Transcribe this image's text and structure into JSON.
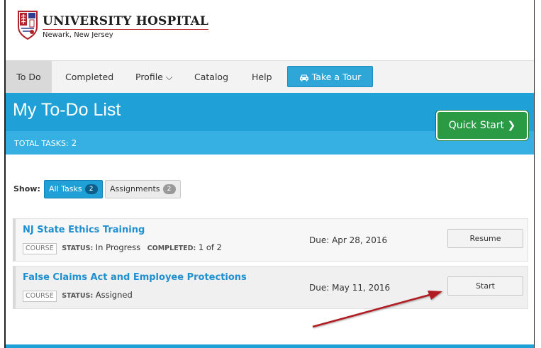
{
  "brand": {
    "title": "UNIVERSITY HOSPITAL",
    "subtitle": "Newark, New Jersey",
    "logo_icon": "hospital-shield-logo",
    "accent": "#b0232a"
  },
  "nav": {
    "items": [
      {
        "label": "To Do",
        "active": true
      },
      {
        "label": "Completed"
      },
      {
        "label": "Profile ⌵"
      },
      {
        "label": "Catalog"
      },
      {
        "label": "Help"
      }
    ],
    "tour_label": "Take a Tour",
    "tour_icon": "car-icon",
    "tour_color": "#2ea7d8"
  },
  "banner": {
    "title": "My To-Do List",
    "quick_start_label": "Quick Start ❯",
    "total_tasks_label": "TOTAL TASKS:",
    "total_tasks_count": "2",
    "color": "#1fa0d6",
    "quick_start_color": "#2a9a45"
  },
  "filters": {
    "show_label": "Show:",
    "all_tasks_label": "All Tasks",
    "all_tasks_count": "2",
    "assignments_label": "Assignments",
    "assignments_count": "2"
  },
  "tasks": [
    {
      "title": "NJ State Ethics Training",
      "type": "COURSE",
      "status_key": "STATUS:",
      "status": "In Progress",
      "completed_key": "COMPLETED:",
      "completed": "1 of 2",
      "due": "Due: Apr 28, 2016",
      "action": "Resume"
    },
    {
      "title": "False Claims Act and Employee Protections",
      "type": "COURSE",
      "status_key": "STATUS:",
      "status": "Assigned",
      "due": "Due: May 11, 2016",
      "action": "Start"
    }
  ],
  "annotation": {
    "arrow_icon": "red-arrow-icon",
    "color": "#b11e22"
  }
}
